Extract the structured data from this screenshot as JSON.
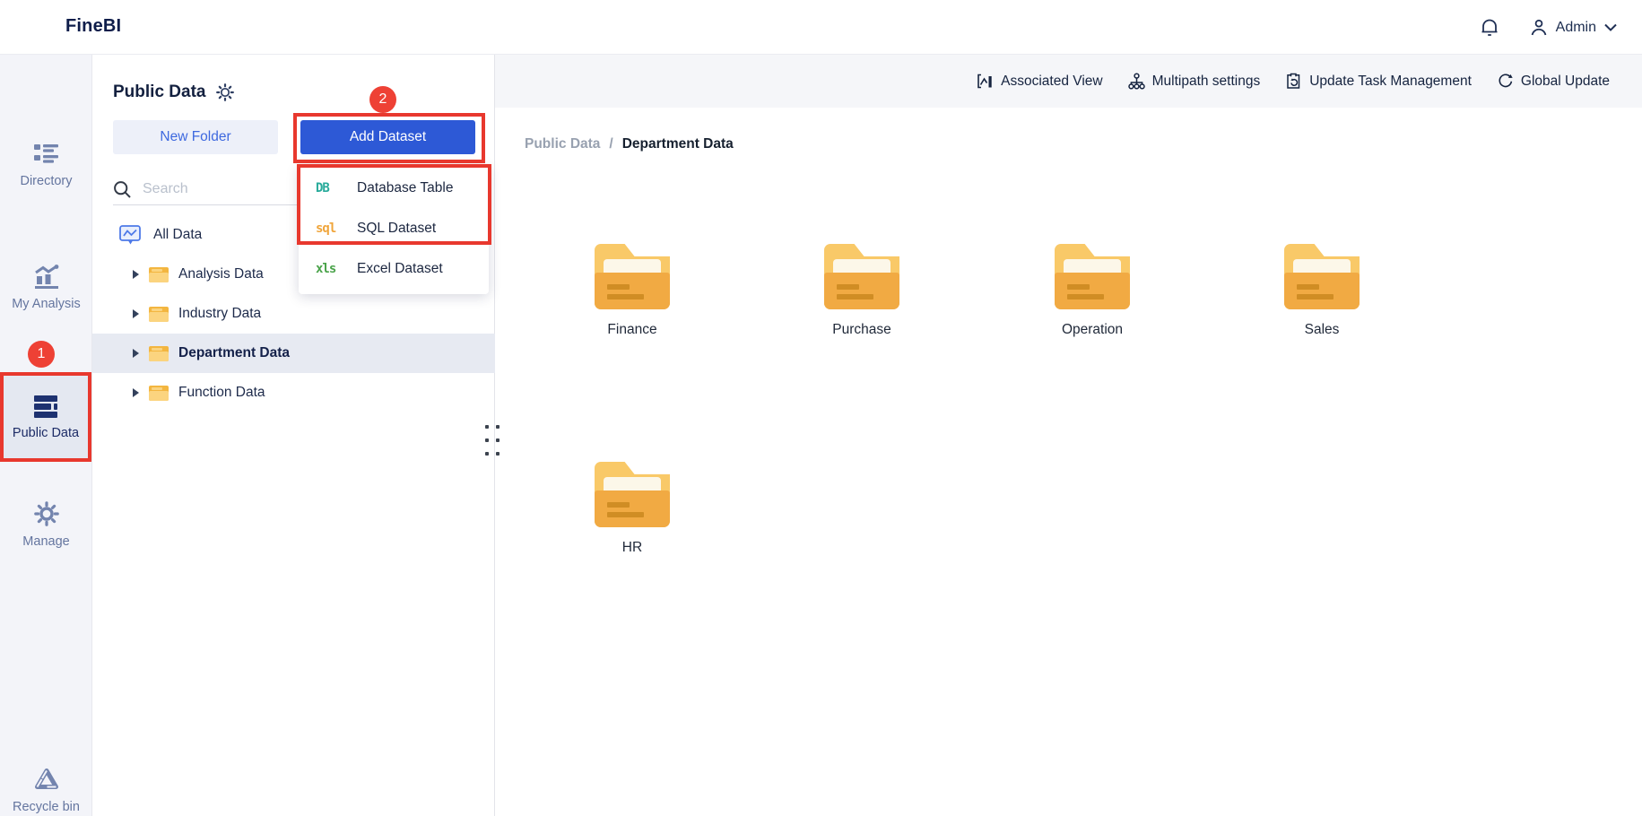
{
  "header": {
    "app_title": "FineBI",
    "user_name": "Admin"
  },
  "sidebar": {
    "items": [
      {
        "label": "Directory"
      },
      {
        "label": "My Analysis"
      },
      {
        "label": "Public Data",
        "selected": true
      },
      {
        "label": "Manage"
      },
      {
        "label": "Recycle bin"
      }
    ]
  },
  "annotations": {
    "step1": "1",
    "step2": "2",
    "highlight_color": "#e8382e"
  },
  "panel": {
    "title": "Public Data",
    "new_folder_label": "New Folder",
    "add_dataset_label": "Add Dataset",
    "search_placeholder": "Search",
    "tree": {
      "root_label": "All Data",
      "items": [
        {
          "label": "Analysis Data"
        },
        {
          "label": "Industry Data"
        },
        {
          "label": "Department Data",
          "selected": true
        },
        {
          "label": "Function Data"
        }
      ]
    }
  },
  "add_dataset_menu": {
    "items": [
      {
        "icon_text": "DB",
        "label": "Database Table",
        "icon_color": "#29ab9b"
      },
      {
        "icon_text": "sql",
        "label": "SQL Dataset",
        "icon_color": "#f0a53b"
      },
      {
        "icon_text": "xls",
        "label": "Excel Dataset",
        "icon_color": "#4aa34a"
      }
    ]
  },
  "toolbar": {
    "items": [
      {
        "label": "Associated View"
      },
      {
        "label": "Multipath settings"
      },
      {
        "label": "Update Task Management"
      },
      {
        "label": "Global Update"
      }
    ]
  },
  "breadcrumb": {
    "parent": "Public Data",
    "separator": "/",
    "current": "Department Data"
  },
  "content": {
    "folders": [
      {
        "name": "Finance"
      },
      {
        "name": "Purchase"
      },
      {
        "name": "Operation"
      },
      {
        "name": "Sales"
      },
      {
        "name": "HR"
      }
    ]
  },
  "colors": {
    "primary_blue": "#2d59d6",
    "annotation_red": "#e8382e",
    "folder_yellow": "#f1aa43",
    "selected_bg": "#e4e8f1"
  }
}
